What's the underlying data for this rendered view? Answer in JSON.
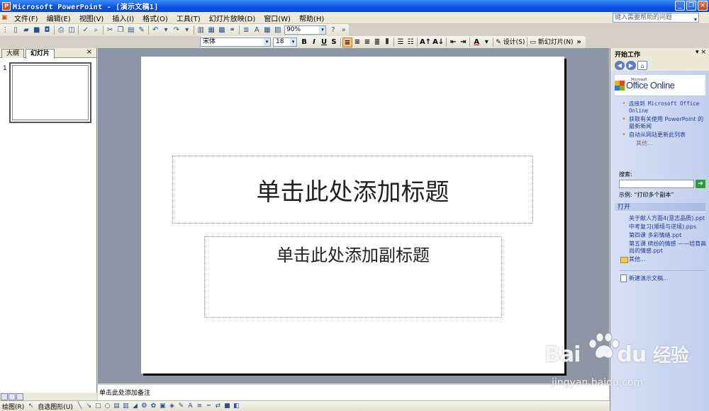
{
  "window": {
    "title": "Microsoft PowerPoint - [演示文稿1]",
    "app_icon": "P"
  },
  "menubar": {
    "items": [
      "文件(F)",
      "编辑(E)",
      "视图(V)",
      "插入(I)",
      "格式(O)",
      "工具(T)",
      "幻灯片放映(D)",
      "窗口(W)",
      "帮助(H)"
    ],
    "help_placeholder": "键入需要帮助的问题"
  },
  "standard_toolbar": {
    "zoom": "90%"
  },
  "format_toolbar": {
    "font": "宋体",
    "size": "18",
    "bold": "B",
    "italic": "I",
    "underline": "U",
    "shadow": "S",
    "design": "设计(S)",
    "new_slide": "新幻灯片(N)"
  },
  "left_pane": {
    "tab_outline": "大纲",
    "tab_slides": "幻灯片",
    "close": "×",
    "slide_number": "1"
  },
  "slide": {
    "title_placeholder": "单击此处添加标题",
    "subtitle_placeholder": "单击此处添加副标题"
  },
  "notes": {
    "placeholder": "单击此处添加备注"
  },
  "drawing_toolbar": {
    "draw": "绘图(R)",
    "autoshapes": "自选图形(U)"
  },
  "task_pane": {
    "title": "开始工作",
    "office_online": "Office Online",
    "office_small": "Microsoft",
    "links": [
      "连接到 Microsoft Office Online",
      "获取有关使用 PowerPoint 的最新新闻",
      "自动从网站更新此列表"
    ],
    "more": "其他...",
    "search_label": "搜索:",
    "search_example": "示例: “打印多个副本”",
    "open_header": "打开",
    "open_files": [
      "关于献人方面4(意志品质).ppt",
      "中考复习(顺境与逆境).pps",
      "第四课 多彩情绪.ppt",
      "第五课 缤纷的情感 ——培育高尚的情感.ppt"
    ],
    "open_more": "其他...",
    "new_doc": "新建演示文稿..."
  },
  "watermark": {
    "brand": "Bai",
    "brand2": "du",
    "brand_cn": "经验",
    "url": "jingyan.baidu.com"
  }
}
